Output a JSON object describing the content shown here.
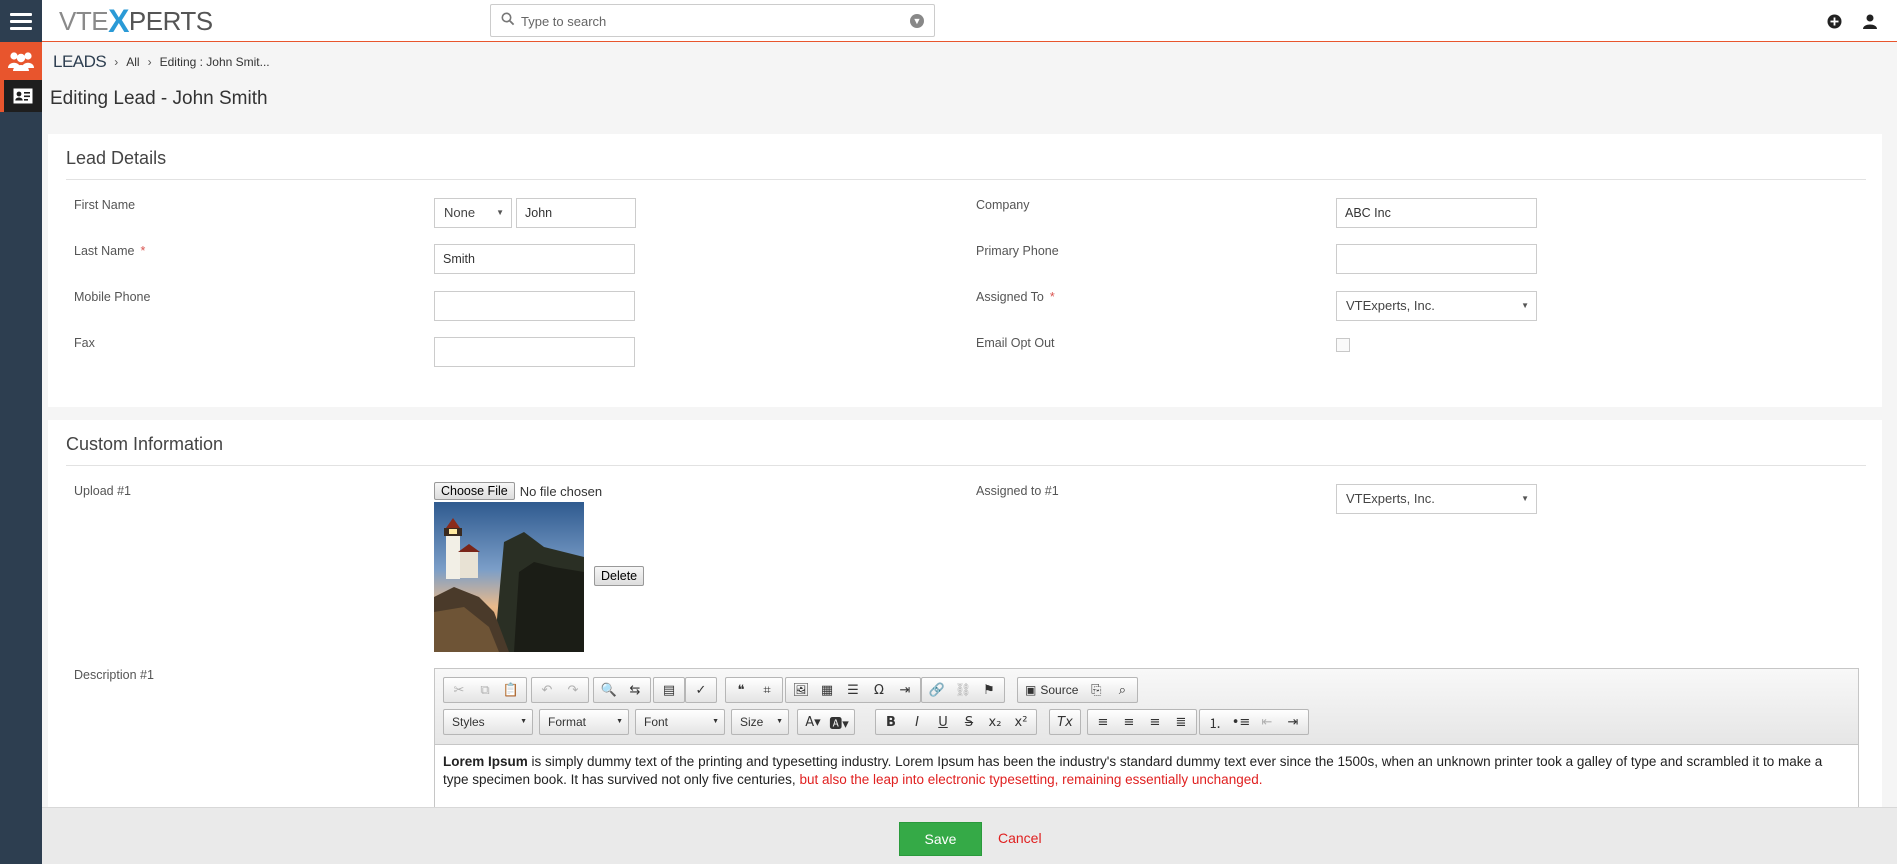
{
  "brand": {
    "logo_part1": "VTE",
    "logo_x": "X",
    "logo_part2": "PERTS"
  },
  "search": {
    "placeholder": "Type to search"
  },
  "breadcrumb": {
    "module": "LEADS",
    "list": "All",
    "current": "Editing : John Smit..."
  },
  "page_title": "Editing Lead - John Smith",
  "lead_details": {
    "title": "Lead Details",
    "first_name_label": "First Name",
    "salutation": "None",
    "first_name_value": "John",
    "last_name_label": "Last Name",
    "last_name_value": "Smith",
    "mobile_phone_label": "Mobile Phone",
    "mobile_phone_value": "",
    "fax_label": "Fax",
    "fax_value": "",
    "company_label": "Company",
    "company_value": "ABC Inc",
    "primary_phone_label": "Primary Phone",
    "primary_phone_value": "",
    "assigned_to_label": "Assigned To",
    "assigned_to_value": "VTExperts, Inc.",
    "email_opt_out_label": "Email Opt Out",
    "required_mark": "*"
  },
  "custom_info": {
    "title": "Custom Information",
    "upload_label": "Upload #1",
    "choose_file_label": "Choose File",
    "no_file_text": "No file chosen",
    "delete_label": "Delete",
    "assigned_label": "Assigned to #1",
    "assigned_value": "VTExperts, Inc.",
    "description_label": "Description #1"
  },
  "editor": {
    "source_label": "Source",
    "styles_label": "Styles",
    "format_label": "Format",
    "font_label": "Font",
    "size_label": "Size",
    "content_bold": "Lorem Ipsum",
    "content_normal": " is simply dummy text of the printing and typesetting industry. Lorem Ipsum has been the industry's standard dummy text ever since the 1500s, when an unknown printer took a galley of type and scrambled it to make a type specimen book. It has survived not only five centuries, ",
    "content_red": "but also the leap into electronic typesetting, remaining essentially unchanged."
  },
  "footer": {
    "save_label": "Save",
    "cancel_label": "Cancel"
  },
  "colors": {
    "accent": "#e8552d",
    "sidebar": "#2d3e50",
    "save": "#35aa47",
    "cancel": "#e02020"
  }
}
